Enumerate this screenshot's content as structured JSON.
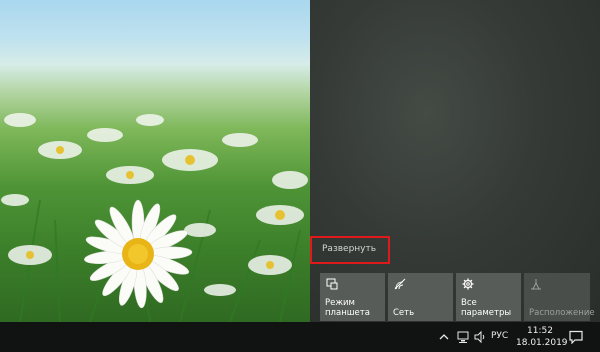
{
  "action_center": {
    "expand_label": "Развернуть",
    "tiles": [
      {
        "label": "Режим\nпланшета",
        "icon": "tablet-mode-icon",
        "enabled": true
      },
      {
        "label": "Сеть",
        "icon": "network-icon",
        "enabled": true
      },
      {
        "label": "Все параметры",
        "icon": "gear-icon",
        "enabled": true
      },
      {
        "label": "Расположение",
        "icon": "location-icon",
        "enabled": false
      }
    ]
  },
  "taskbar": {
    "language": "РУС",
    "time": "11:52",
    "date": "18.01.2019"
  },
  "colors": {
    "highlight_border": "#e01a1a",
    "tile_bg": "#575c58",
    "taskbar_bg": "#111312"
  }
}
